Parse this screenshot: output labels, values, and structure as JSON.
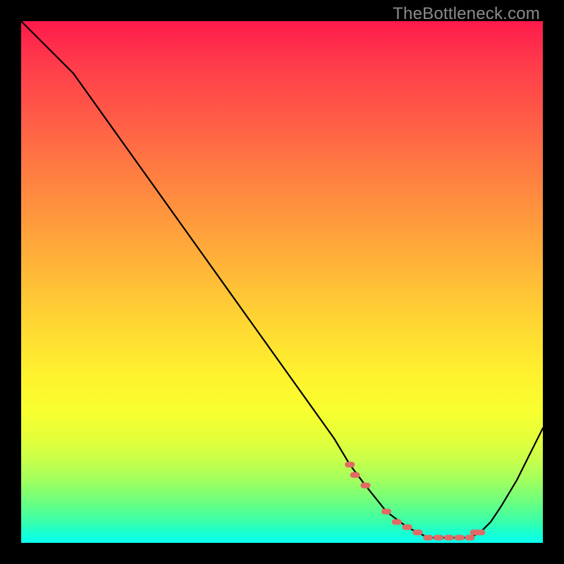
{
  "watermark": "TheBottleneck.com",
  "chart_data": {
    "type": "line",
    "title": "",
    "xlabel": "",
    "ylabel": "",
    "xlim": [
      0,
      100
    ],
    "ylim": [
      0,
      100
    ],
    "background_gradient": {
      "top": "#ff1a4b",
      "bottom": "#0affef"
    },
    "series": [
      {
        "name": "bottleneck-curve",
        "x": [
          0,
          5,
          10,
          15,
          20,
          25,
          30,
          35,
          40,
          45,
          50,
          55,
          60,
          63,
          66,
          70,
          74,
          78,
          82,
          86,
          88,
          90,
          92,
          95,
          98,
          100
        ],
        "y": [
          100,
          95,
          90,
          83,
          76,
          69,
          62,
          55,
          48,
          41,
          34,
          27,
          20,
          15,
          11,
          6,
          3,
          1,
          1,
          1,
          2,
          4,
          7,
          12,
          18,
          22
        ]
      }
    ],
    "markers": {
      "name": "highlight-points",
      "x": [
        63,
        64,
        66,
        70,
        72,
        74,
        76,
        78,
        80,
        82,
        84,
        86,
        87,
        88
      ],
      "y": [
        15,
        13,
        11,
        6,
        4,
        3,
        2,
        1,
        1,
        1,
        1,
        1,
        2,
        2
      ]
    }
  }
}
